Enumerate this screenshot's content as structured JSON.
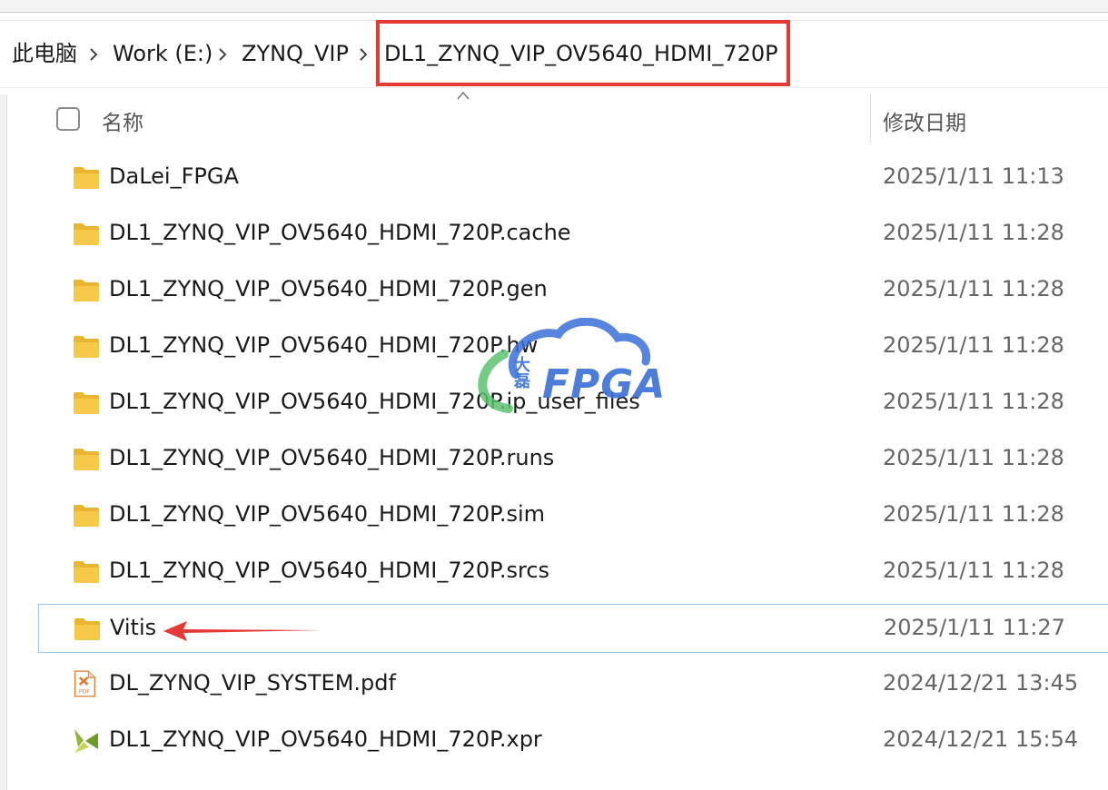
{
  "breadcrumb": {
    "items": [
      "此电脑",
      "Work (E:)",
      "ZYNQ_VIP",
      "DL1_ZYNQ_VIP_OV5640_HDMI_720P"
    ]
  },
  "columns": {
    "name": "名称",
    "date": "修改日期"
  },
  "files": [
    {
      "name": "DaLei_FPGA",
      "date": "2025/1/11 11:13",
      "type": "folder"
    },
    {
      "name": "DL1_ZYNQ_VIP_OV5640_HDMI_720P.cache",
      "date": "2025/1/11 11:28",
      "type": "folder"
    },
    {
      "name": "DL1_ZYNQ_VIP_OV5640_HDMI_720P.gen",
      "date": "2025/1/11 11:28",
      "type": "folder"
    },
    {
      "name": "DL1_ZYNQ_VIP_OV5640_HDMI_720P.hw",
      "date": "2025/1/11 11:28",
      "type": "folder"
    },
    {
      "name": "DL1_ZYNQ_VIP_OV5640_HDMI_720P.ip_user_files",
      "date": "2025/1/11 11:28",
      "type": "folder"
    },
    {
      "name": "DL1_ZYNQ_VIP_OV5640_HDMI_720P.runs",
      "date": "2025/1/11 11:28",
      "type": "folder"
    },
    {
      "name": "DL1_ZYNQ_VIP_OV5640_HDMI_720P.sim",
      "date": "2025/1/11 11:28",
      "type": "folder"
    },
    {
      "name": "DL1_ZYNQ_VIP_OV5640_HDMI_720P.srcs",
      "date": "2025/1/11 11:28",
      "type": "folder"
    },
    {
      "name": "Vitis",
      "date": "2025/1/11 11:27",
      "type": "folder",
      "selected": true
    },
    {
      "name": "DL_ZYNQ_VIP_SYSTEM.pdf",
      "date": "2024/12/21 13:45",
      "type": "pdf"
    },
    {
      "name": "DL1_ZYNQ_VIP_OV5640_HDMI_720P.xpr",
      "date": "2024/12/21 15:54",
      "type": "xpr"
    }
  ],
  "watermark": {
    "brand": "FPGA",
    "cn": "大磊"
  },
  "colors": {
    "highlight": "#e53935",
    "folder": "#f7c948",
    "selection_border": "#99c9ef",
    "watermark": "#3a6fd8"
  }
}
